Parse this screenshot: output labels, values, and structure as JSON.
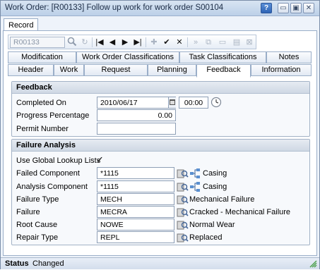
{
  "window": {
    "title": "Work Order: [R00133] Follow up work for work order S00104",
    "help": "?",
    "minimize": "▭",
    "maximize": "▣",
    "close": "✕"
  },
  "record_tab": "Record",
  "toolbar": {
    "record_placeholder": "R00133",
    "icons": [
      "search-icon",
      "refresh-icon",
      "first-icon",
      "prev-icon",
      "next-icon",
      "last-icon",
      "add-icon",
      "save-icon",
      "cancel-icon",
      "forward-icon",
      "copy-icon",
      "print-icon",
      "delete-icon"
    ]
  },
  "tabs_row1": [
    "Modification",
    "Work Order Classifications",
    "Task Classifications",
    "Notes"
  ],
  "tabs_row2": [
    "Header",
    "Work",
    "Request",
    "Planning",
    "Feedback",
    "Information"
  ],
  "active_tab": "Feedback",
  "feedback": {
    "title": "Feedback",
    "completed_on_label": "Completed On",
    "completed_on_date": "2010/06/17",
    "completed_on_time": "00:00",
    "progress_label": "Progress Percentage",
    "progress_value": "0.00",
    "permit_label": "Permit Number",
    "permit_value": ""
  },
  "failure": {
    "title": "Failure Analysis",
    "use_global_label": "Use Global Lookup Lists",
    "use_global_checked": true,
    "checkmark": "✓",
    "rows": [
      {
        "label": "Failed Component",
        "value": "*1115",
        "desc": "Casing"
      },
      {
        "label": "Analysis Component",
        "value": "*1115",
        "desc": "Casing"
      },
      {
        "label": "Failure Type",
        "value": "MECH",
        "desc": "Mechanical Failure"
      },
      {
        "label": "Failure",
        "value": "MECRA",
        "desc": "Cracked - Mechanical Failure"
      },
      {
        "label": "Root Cause",
        "value": "NOWE",
        "desc": "Normal Wear"
      },
      {
        "label": "Repair Type",
        "value": "REPL",
        "desc": "Replaced"
      }
    ]
  },
  "status": {
    "label": "Status",
    "value": "Changed"
  }
}
